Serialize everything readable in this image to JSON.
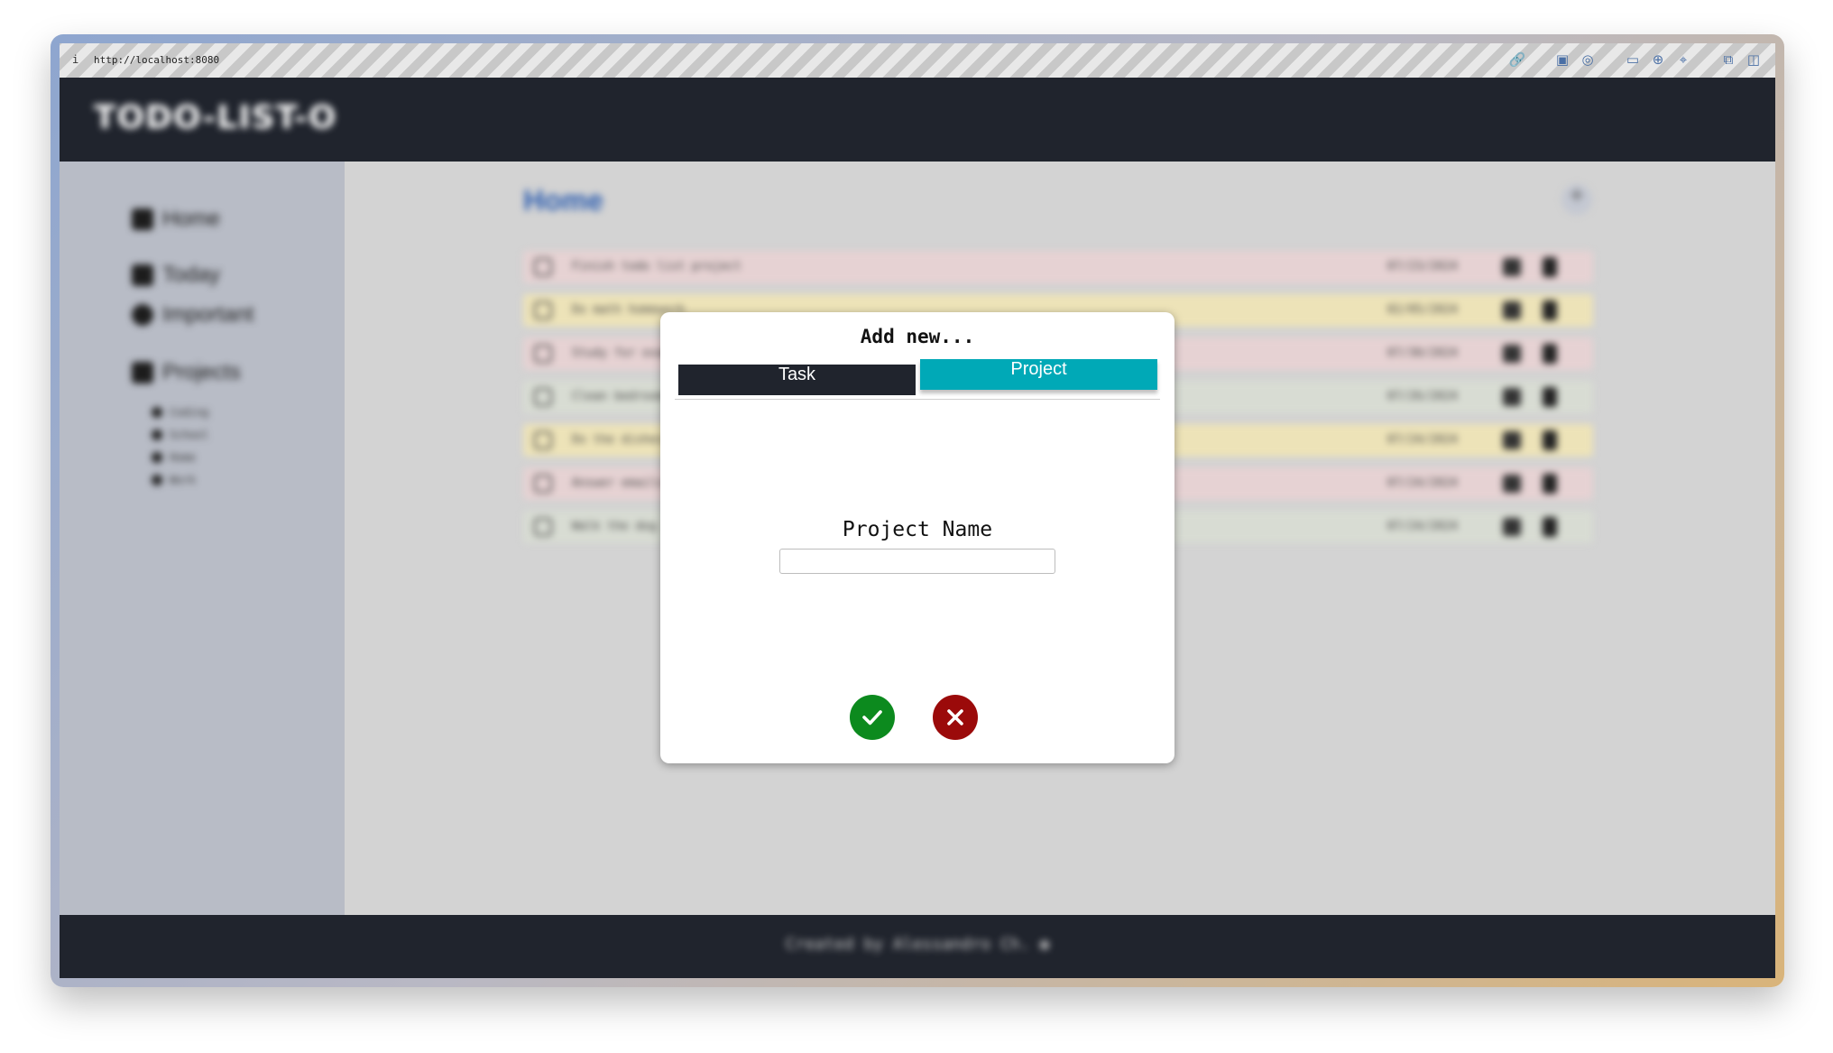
{
  "browser": {
    "info_glyph": "i",
    "url": "http://localhost:8080",
    "toolbar_icons": [
      "link-icon",
      "screenshot-icon",
      "camera-icon",
      "terminal-icon",
      "globe-icon",
      "crosshair-icon",
      "extension-icon",
      "sidebar-icon"
    ]
  },
  "app": {
    "brand": "TODO-LIST-O",
    "sidebar": {
      "items": [
        {
          "label": "Home",
          "icon": "home-icon"
        },
        {
          "label": "Today",
          "icon": "calendar-icon"
        },
        {
          "label": "Important",
          "icon": "alert-icon"
        },
        {
          "label": "Projects",
          "icon": "folder-icon"
        }
      ],
      "projects": [
        "Coding",
        "School",
        "Home",
        "Work"
      ]
    },
    "main": {
      "title": "Home",
      "add_glyph": "+",
      "todos": [
        {
          "text": "Finish todo list project",
          "date": "07/23/2024",
          "color": "#e6d2d3"
        },
        {
          "text": "Do math homework",
          "date": "02/05/2024",
          "color": "#ede3b8"
        },
        {
          "text": "Study for exams",
          "date": "07/30/2024",
          "color": "#e6d2d3"
        },
        {
          "text": "Clean bedroom",
          "date": "07/26/2024",
          "color": "#d8dcd3"
        },
        {
          "text": "Do the dishes",
          "date": "07/24/2024",
          "color": "#ede3b8"
        },
        {
          "text": "Answer emails",
          "date": "07/24/2024",
          "color": "#e6d2d3"
        },
        {
          "text": "Walk the dog",
          "date": "07/24/2024",
          "color": "#d8dcd3"
        }
      ]
    },
    "footer": "Created by Alessandro Ch."
  },
  "modal": {
    "title": "Add new...",
    "tabs": {
      "task": "Task",
      "project": "Project"
    },
    "field_label": "Project Name",
    "field_value": "",
    "colors": {
      "confirm": "#0c8a1e",
      "cancel": "#9b0a0a",
      "active_tab": "#00a9b7",
      "inactive_tab": "#20242d"
    }
  }
}
